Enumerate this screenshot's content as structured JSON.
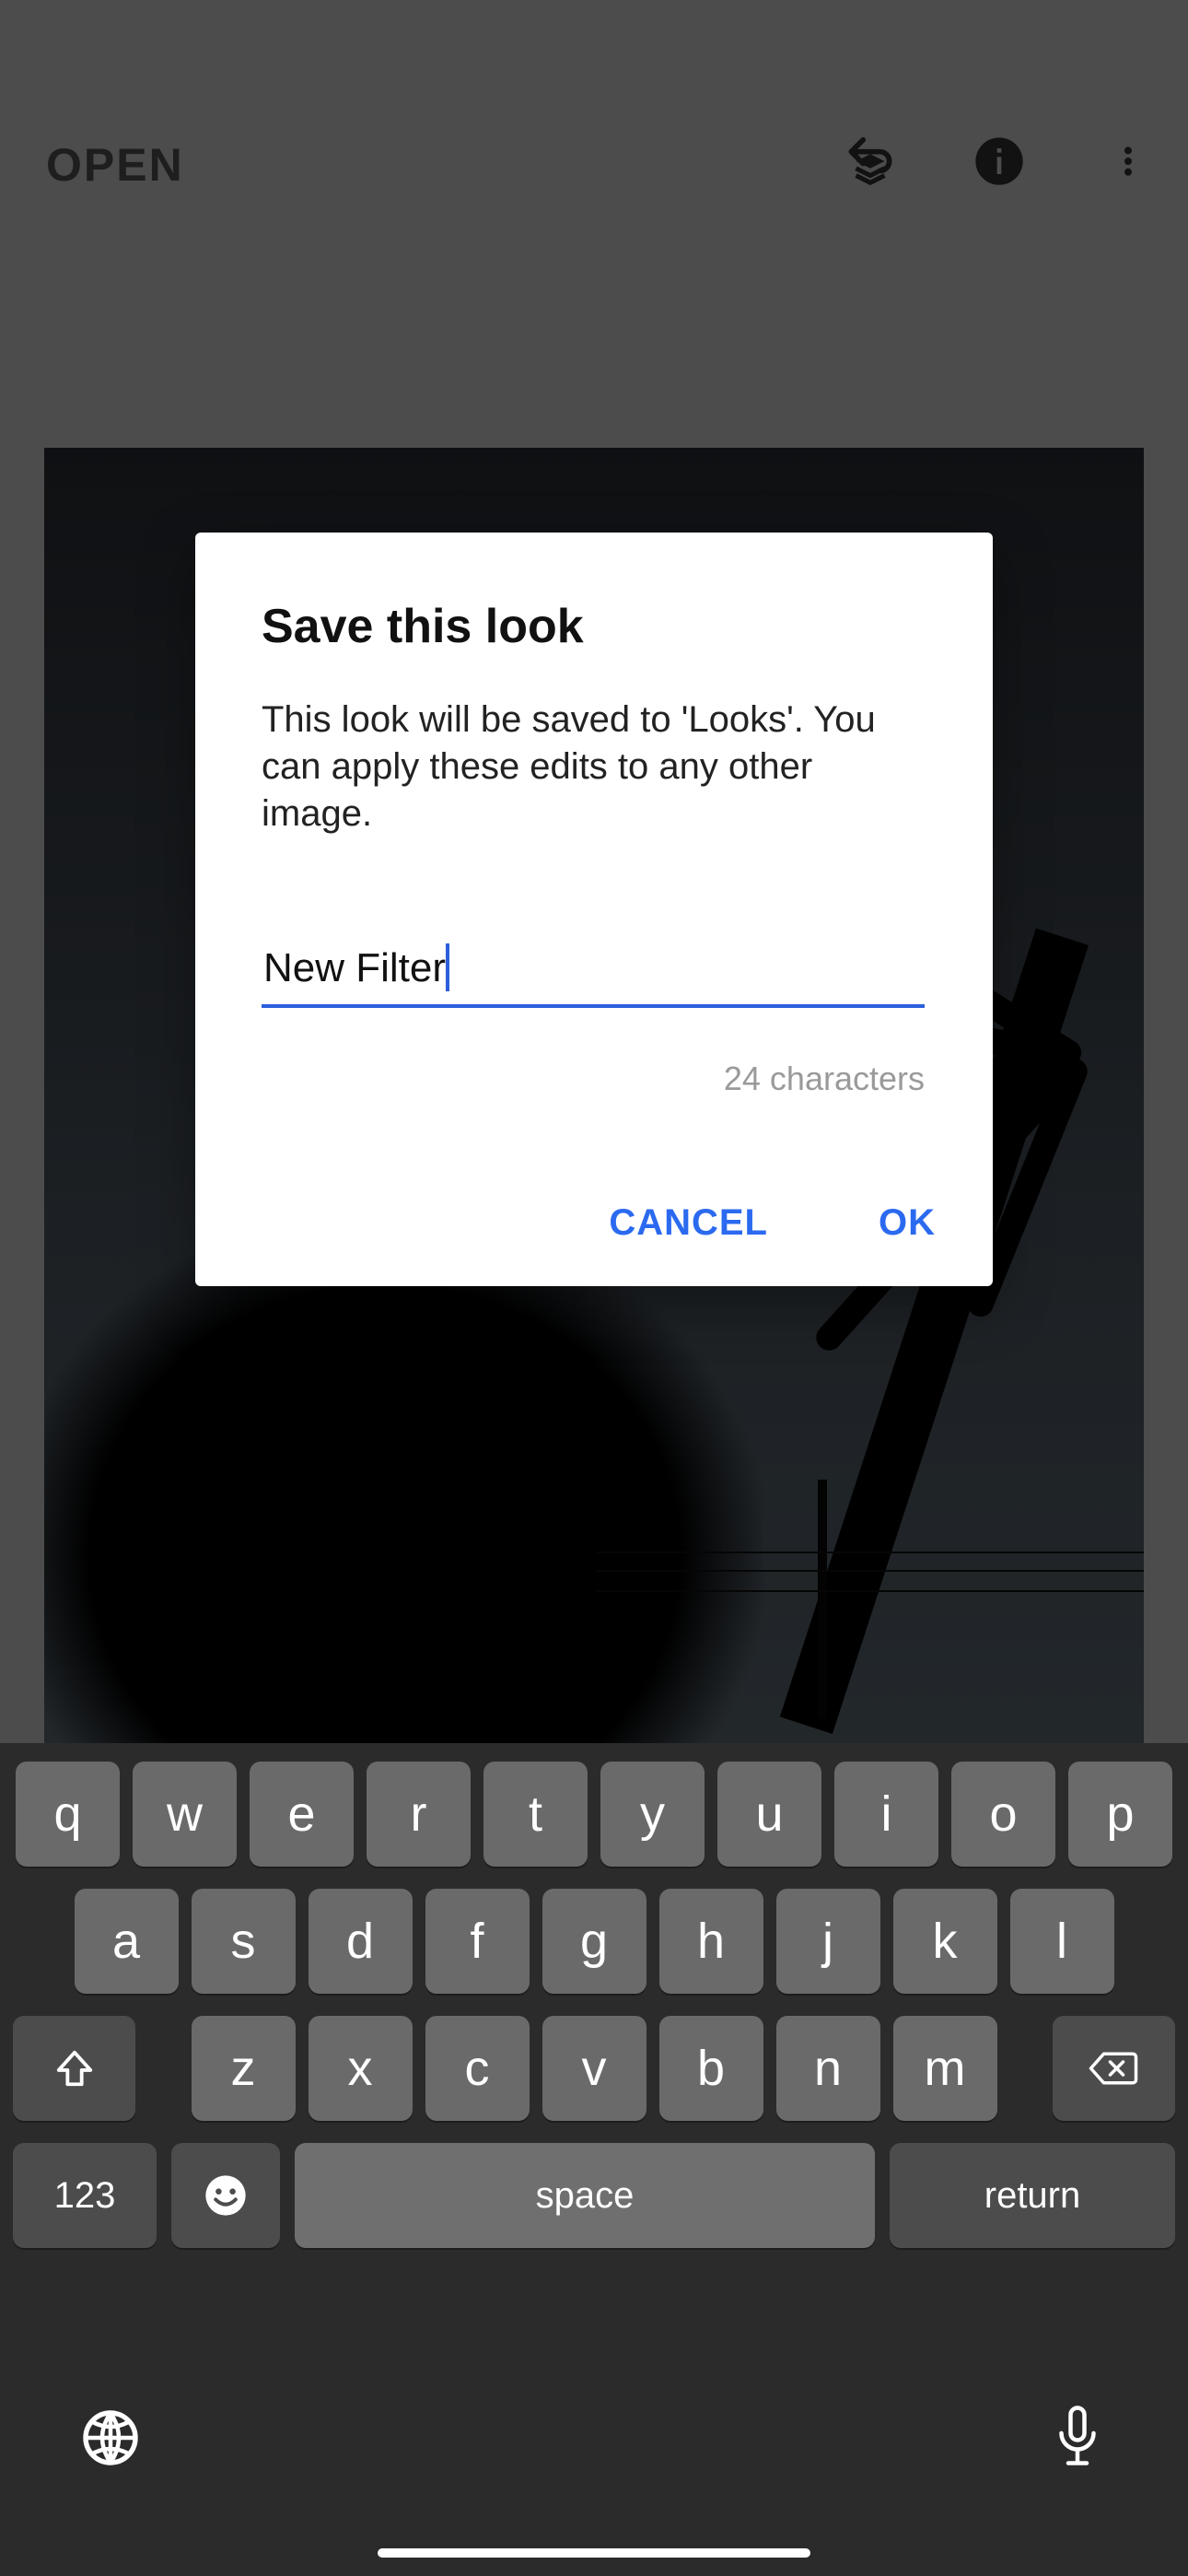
{
  "topbar": {
    "open_label": "OPEN"
  },
  "dialog": {
    "title": "Save this look",
    "description": "This look will be saved to 'Looks'. You can apply these edits to any other image.",
    "input_value": "New Filter",
    "char_limit_label": "24 characters",
    "cancel_label": "CANCEL",
    "ok_label": "OK"
  },
  "keyboard": {
    "row1": [
      "q",
      "w",
      "e",
      "r",
      "t",
      "y",
      "u",
      "i",
      "o",
      "p"
    ],
    "row2": [
      "a",
      "s",
      "d",
      "f",
      "g",
      "h",
      "j",
      "k",
      "l"
    ],
    "row3": [
      "z",
      "x",
      "c",
      "v",
      "b",
      "n",
      "m"
    ],
    "numbers_label": "123",
    "space_label": "space",
    "return_label": "return"
  }
}
